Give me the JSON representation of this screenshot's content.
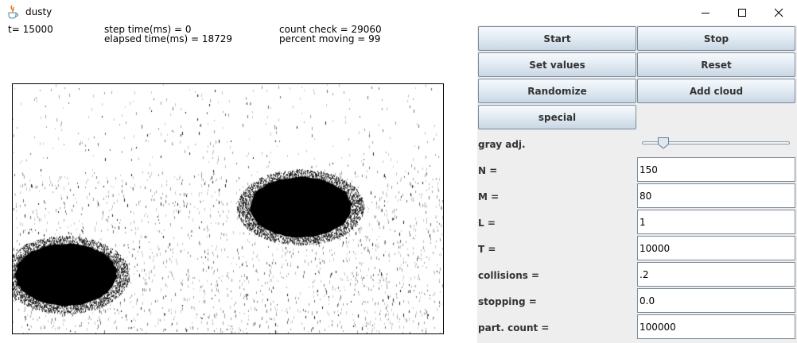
{
  "window": {
    "title": "dusty"
  },
  "status": {
    "t": "t= 15000",
    "step_time": "step time(ms) = 0",
    "elapsed_time": "elapsed time(ms) = 18729",
    "count_check": "count check = 29060",
    "percent_moving": "percent moving = 99"
  },
  "simulation": {
    "blobs": [
      {
        "label": "upper-right cloud"
      },
      {
        "label": "lower-left cloud"
      }
    ]
  },
  "controls": {
    "buttons": {
      "start": "Start",
      "stop": "Stop",
      "set_values": "Set values",
      "reset": "Reset",
      "randomize": "Randomize",
      "add_cloud": "Add cloud",
      "special": "special"
    },
    "gray_adj": {
      "label": "gray adj.",
      "value_fraction": 0.11
    },
    "params": [
      {
        "label": "N =",
        "value": "150"
      },
      {
        "label": "M =",
        "value": "80"
      },
      {
        "label": "L =",
        "value": "1"
      },
      {
        "label": "T =",
        "value": "10000"
      },
      {
        "label": "collisions =",
        "value": ".2"
      },
      {
        "label": "stopping =",
        "value": "0.0"
      },
      {
        "label": "part. count =",
        "value": "100000"
      }
    ]
  },
  "colors": {
    "panel_bg": "#eeeeee",
    "button_text": "#333333",
    "particle": "#000000"
  },
  "icons": [
    "java-app-icon",
    "minimize-icon",
    "maximize-icon",
    "close-icon"
  ]
}
